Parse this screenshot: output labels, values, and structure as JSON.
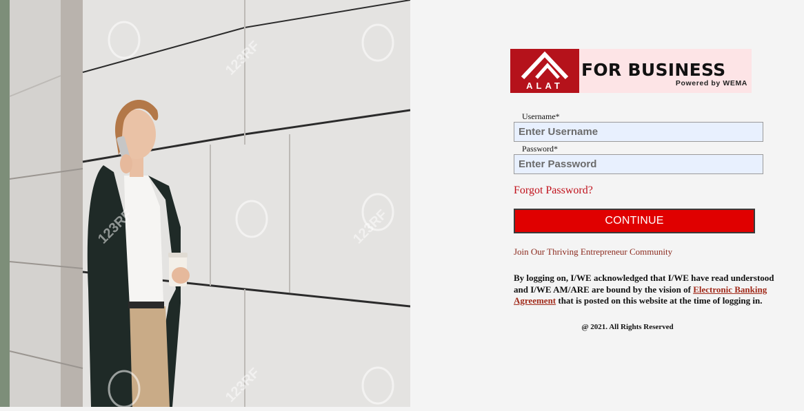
{
  "brand": {
    "logo_word": "ALAT",
    "title": "FOR BUSINESS",
    "subtitle": "Powered by WEMA",
    "colors": {
      "brand_red": "#b5121b",
      "logo_bg": "#fde4e6",
      "button_red": "#e00000"
    }
  },
  "login": {
    "username_label": "Username*",
    "username_placeholder": "Enter Username",
    "username_value": "",
    "password_label": "Password*",
    "password_placeholder": "Enter Password",
    "password_value": "",
    "forgot_link": "Forgot Password?",
    "continue_button": "CONTINUE"
  },
  "community_link": "Join Our Thriving Entrepreneur Community",
  "disclaimer": {
    "before": "By logging on, I/WE acknowledged that I/WE have read understood and I/WE AM/ARE are bound by the vision of ",
    "link": "Electronic Banking Agreement",
    "after": " that is posted on this website at the time of logging in."
  },
  "footer": "@ 2021. All Rights Reserved",
  "photo": {
    "description_icon": "woman-on-phone-photo",
    "watermark": "123RF"
  }
}
